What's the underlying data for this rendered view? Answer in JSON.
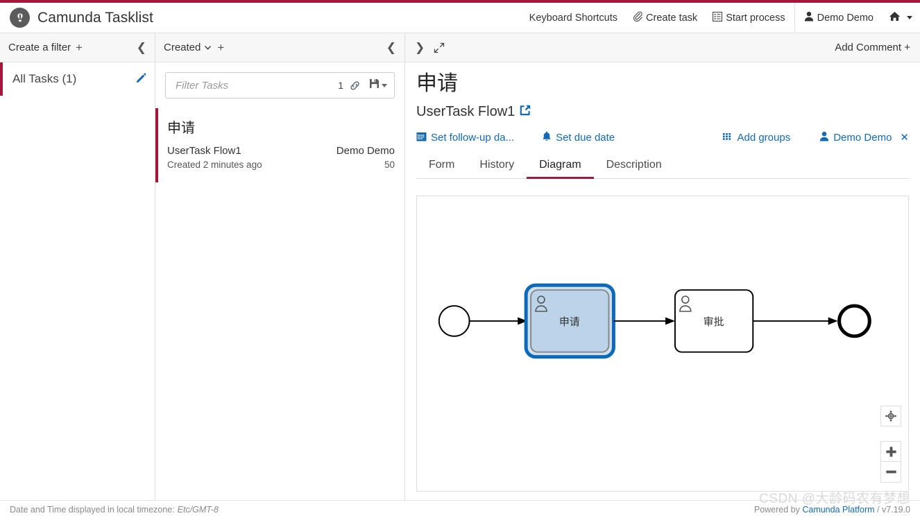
{
  "header": {
    "brand_title": "Camunda Tasklist",
    "logo_icon": "camunda-c-logo",
    "keyboard_shortcuts": "Keyboard Shortcuts",
    "create_task": "Create task",
    "create_task_icon": "paperclip-icon",
    "start_process": "Start process",
    "start_process_icon": "list-icon",
    "user": "Demo Demo",
    "user_icon": "person-icon",
    "home_icon": "home-icon"
  },
  "filters": {
    "head_label": "Create a filter",
    "head_plus": "+",
    "collapse_icon": "chevron-left-icon",
    "items": [
      {
        "label": "All Tasks (1)",
        "edit_icon": "pencil-icon"
      }
    ]
  },
  "tasks": {
    "sort_label": "Created",
    "sort_caret_icon": "chevron-down-icon",
    "add_sort": "+",
    "collapse_icon": "chevron-left-icon",
    "search_placeholder": "Filter Tasks",
    "search_value": "",
    "result_count": "1",
    "link_icon": "link-icon",
    "save_icon": "floppy-disk-icon",
    "list": [
      {
        "title": "申请",
        "process": "UserTask Flow1",
        "assignee": "Demo Demo",
        "created": "Created 2 minutes ago",
        "priority": "50"
      }
    ]
  },
  "detail": {
    "collapse_icon": "chevron-right-icon",
    "expand_icon": "expand-arrows-icon",
    "add_comment": "Add Comment +",
    "title": "申请",
    "subtitle": "UserTask Flow1",
    "subtitle_link_icon": "external-link-icon",
    "actions": [
      {
        "label": "Set follow-up da...",
        "icon": "calendar-icon"
      },
      {
        "label": "Set due date",
        "icon": "bell-icon"
      },
      {
        "label": "Add groups",
        "icon": "grid-icon"
      },
      {
        "label": "Demo Demo",
        "icon": "person-icon"
      }
    ],
    "remove_assignee_icon": "close-x-icon",
    "tabs": [
      {
        "label": "Form",
        "active": false
      },
      {
        "label": "History",
        "active": false
      },
      {
        "label": "Diagram",
        "active": true
      },
      {
        "label": "Description",
        "active": false
      }
    ],
    "diagram": {
      "selected_task": "申请",
      "nodes": [
        {
          "type": "start-event",
          "label": ""
        },
        {
          "type": "user-task",
          "label": "申请",
          "selected": true
        },
        {
          "type": "user-task",
          "label": "审批",
          "selected": false
        },
        {
          "type": "end-event",
          "label": ""
        }
      ],
      "controls": [
        {
          "name": "reset-zoom",
          "icon": "crosshair-icon"
        },
        {
          "name": "zoom-in",
          "icon": "plus-icon"
        },
        {
          "name": "zoom-out",
          "icon": "minus-icon"
        }
      ]
    }
  },
  "footer": {
    "timezone_prefix": "Date and Time displayed in local timezone:",
    "timezone": "Etc/GMT-8",
    "powered_prefix": "Powered by ",
    "powered_link": "Camunda Platform",
    "powered_version": " / v7.19.0"
  },
  "watermark": "CSDN @大龄码农有梦想",
  "colors": {
    "accent_crimson": "#a4173c",
    "link_blue": "#1469b4",
    "selected_task_fill": "#bcd4ea",
    "selected_task_stroke": "#0d6ab8"
  }
}
